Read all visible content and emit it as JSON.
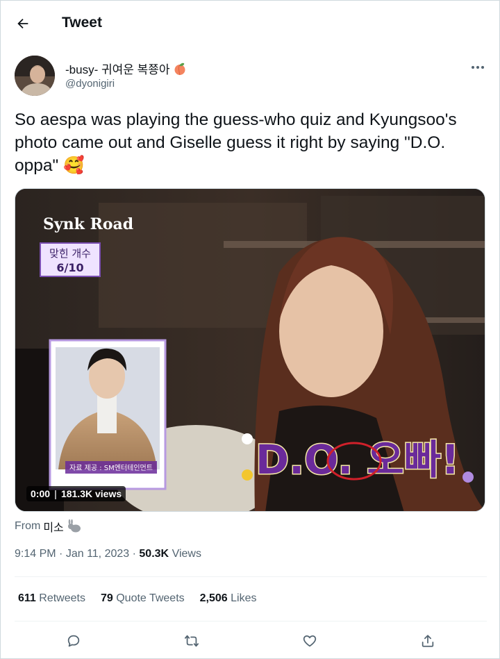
{
  "header": {
    "title": "Tweet"
  },
  "author": {
    "display_name": "-busy- 귀여운 복쭁아",
    "handle": "@dyonigiri"
  },
  "tweet": {
    "text": "So aespa was playing the guess-who quiz and Kyungsoo's photo came out and Giselle guess it right by saying \"D.O. oppa\" 🥰"
  },
  "media": {
    "video_time": "0:00",
    "video_views": "181.3K views",
    "overlay": {
      "logo": "Synk Road",
      "score_label": "맞힌 개수",
      "score_value": "6/10",
      "card_credit": "자료 제공 : SM엔터테인먼트",
      "caption": "D.O. 오빠!"
    }
  },
  "from": {
    "label": "From",
    "name": "미소"
  },
  "meta": {
    "time": "9:14 PM",
    "date": "Jan 11, 2023",
    "views_count": "50.3K",
    "views_label": "Views"
  },
  "stats": {
    "retweets_count": "611",
    "retweets_label": "Retweets",
    "quotes_count": "79",
    "quotes_label": "Quote Tweets",
    "likes_count": "2,506",
    "likes_label": "Likes"
  },
  "icons": {
    "back": "arrow-left-icon",
    "more": "more-dots-icon",
    "reply": "reply-icon",
    "retweet": "retweet-icon",
    "like": "heart-icon",
    "share": "share-icon"
  },
  "colors": {
    "text_primary": "#0f1419",
    "text_secondary": "#536471",
    "divider": "#eff3f4",
    "caption_purple": "#6a2a9a"
  }
}
